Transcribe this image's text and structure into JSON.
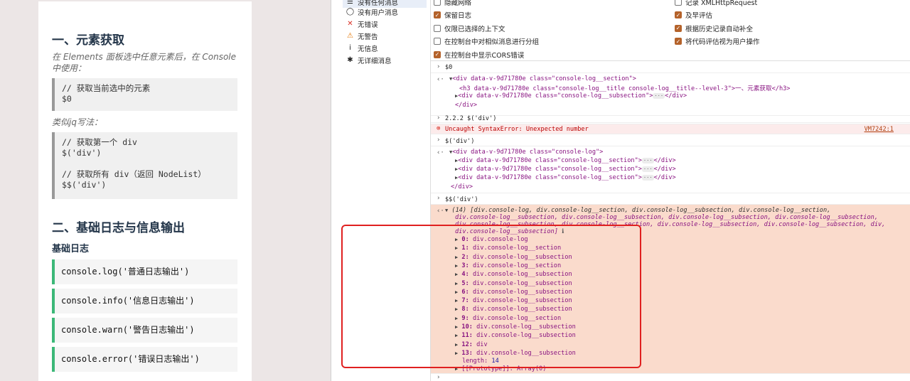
{
  "doc": {
    "section1_title": "一、元素获取",
    "section1_intro": "在 Elements 面板选中任意元素后，在 Console 中使用：",
    "code1": "// 获取当前选中的元素\n$0",
    "jq_note": "类似jq写法：",
    "code2": "// 获取第一个 div\n$('div')\n\n// 获取所有 div（返回 NodeList）\n$$('div')",
    "section2_title": "二、基础日志与信息输出",
    "subsection_title": "基础日志",
    "log_buttons": [
      "console.log('普通日志输出')",
      "console.info('信息日志输出')",
      "console.warn('警告日志输出')",
      "console.error('错误日志输出')"
    ]
  },
  "devtools": {
    "sidebar": [
      {
        "icon": "list-icon",
        "glyph": "☰",
        "label": "没有任何消息",
        "selected": true
      },
      {
        "icon": "user-icon",
        "glyph": "◯",
        "label": "没有用户消息",
        "selected": false
      },
      {
        "icon": "error-icon",
        "glyph": "✕",
        "label": "无错误",
        "selected": false,
        "color": "#d93025"
      },
      {
        "icon": "warning-icon",
        "glyph": "⚠",
        "label": "无警告",
        "selected": false,
        "color": "#e37400"
      },
      {
        "icon": "info-icon",
        "glyph": "i",
        "label": "无信息",
        "selected": false
      },
      {
        "icon": "bug-icon",
        "glyph": "✱",
        "label": "无详细消息",
        "selected": false
      }
    ],
    "settings_left": [
      {
        "label": "隐藏网络",
        "checked": false
      },
      {
        "label": "保留日志",
        "checked": true
      },
      {
        "label": "仅限已选择的上下文",
        "checked": false
      },
      {
        "label": "在控制台中对相似消息进行分组",
        "checked": false
      },
      {
        "label": "在控制台中显示CORS错误",
        "checked": true
      }
    ],
    "settings_right": [
      {
        "label": "记录 XMLHttpRequest",
        "checked": false
      },
      {
        "label": "及早评估",
        "checked": true
      },
      {
        "label": "根据历史记录自动补全",
        "checked": true
      },
      {
        "label": "将代码评估视为用户操作",
        "checked": true
      }
    ],
    "console": {
      "cmd1": "$0",
      "el1_open": "<div data-v-9d71780e class=\"console-log__section\">",
      "el1_child1": "<h3 data-v-9d71780e class=\"console-log__title console-log__title--level-3\">一、元素获取</h3>",
      "el1_child2": "<div data-v-9d71780e class=\"console-log__subsection\">",
      "el1_close": "</div>",
      "cmd2": "2.2.2 $('div')",
      "error_text": "Uncaught SyntaxError: Unexpected number",
      "error_link": "VM7242:1",
      "cmd3": "$('div')",
      "el2_open": "<div data-v-9d71780e class=\"console-log\">",
      "el2_children": [
        "<div data-v-9d71780e class=\"console-log__section\">",
        "<div data-v-9d71780e class=\"console-log__section\">",
        "<div data-v-9d71780e class=\"console-log__section\">"
      ],
      "el2_close": "</div>",
      "cmd4": "$$('div')",
      "array_summary": [
        "(14) [div.console-log, div.console-log__section, div.console-log__subsection, div.console-log__section,",
        "div.console-log__subsection, div.console-log__subsection, div.console-log__subsection, div.console-log__subsection,",
        "div.console-log__subsection, div.console-log__section, div.console-log__subsection, div.console-log__subsection, div,",
        "div.console-log__subsection]"
      ],
      "array_items": [
        {
          "key": "0:",
          "val": "div.console-log"
        },
        {
          "key": "1:",
          "val": "div.console-log__section"
        },
        {
          "key": "2:",
          "val": "div.console-log__subsection"
        },
        {
          "key": "3:",
          "val": "div.console-log__section"
        },
        {
          "key": "4:",
          "val": "div.console-log__subsection"
        },
        {
          "key": "5:",
          "val": "div.console-log__subsection"
        },
        {
          "key": "6:",
          "val": "div.console-log__subsection"
        },
        {
          "key": "7:",
          "val": "div.console-log__subsection"
        },
        {
          "key": "8:",
          "val": "div.console-log__subsection"
        },
        {
          "key": "9:",
          "val": "div.console-log__section"
        },
        {
          "key": "10:",
          "val": "div.console-log__subsection"
        },
        {
          "key": "11:",
          "val": "div.console-log__subsection"
        },
        {
          "key": "12:",
          "val": "div"
        },
        {
          "key": "13:",
          "val": "div.console-log__subsection"
        }
      ],
      "length_key": "length:",
      "length_val": "14",
      "prototype_line": "[[Prototype]]: Array(0)"
    }
  },
  "colors": {
    "accent_green": "#3cb878",
    "checkbox_on": "#b4622a",
    "highlight_box": "#e02020",
    "error_bg": "#fcebeb"
  }
}
